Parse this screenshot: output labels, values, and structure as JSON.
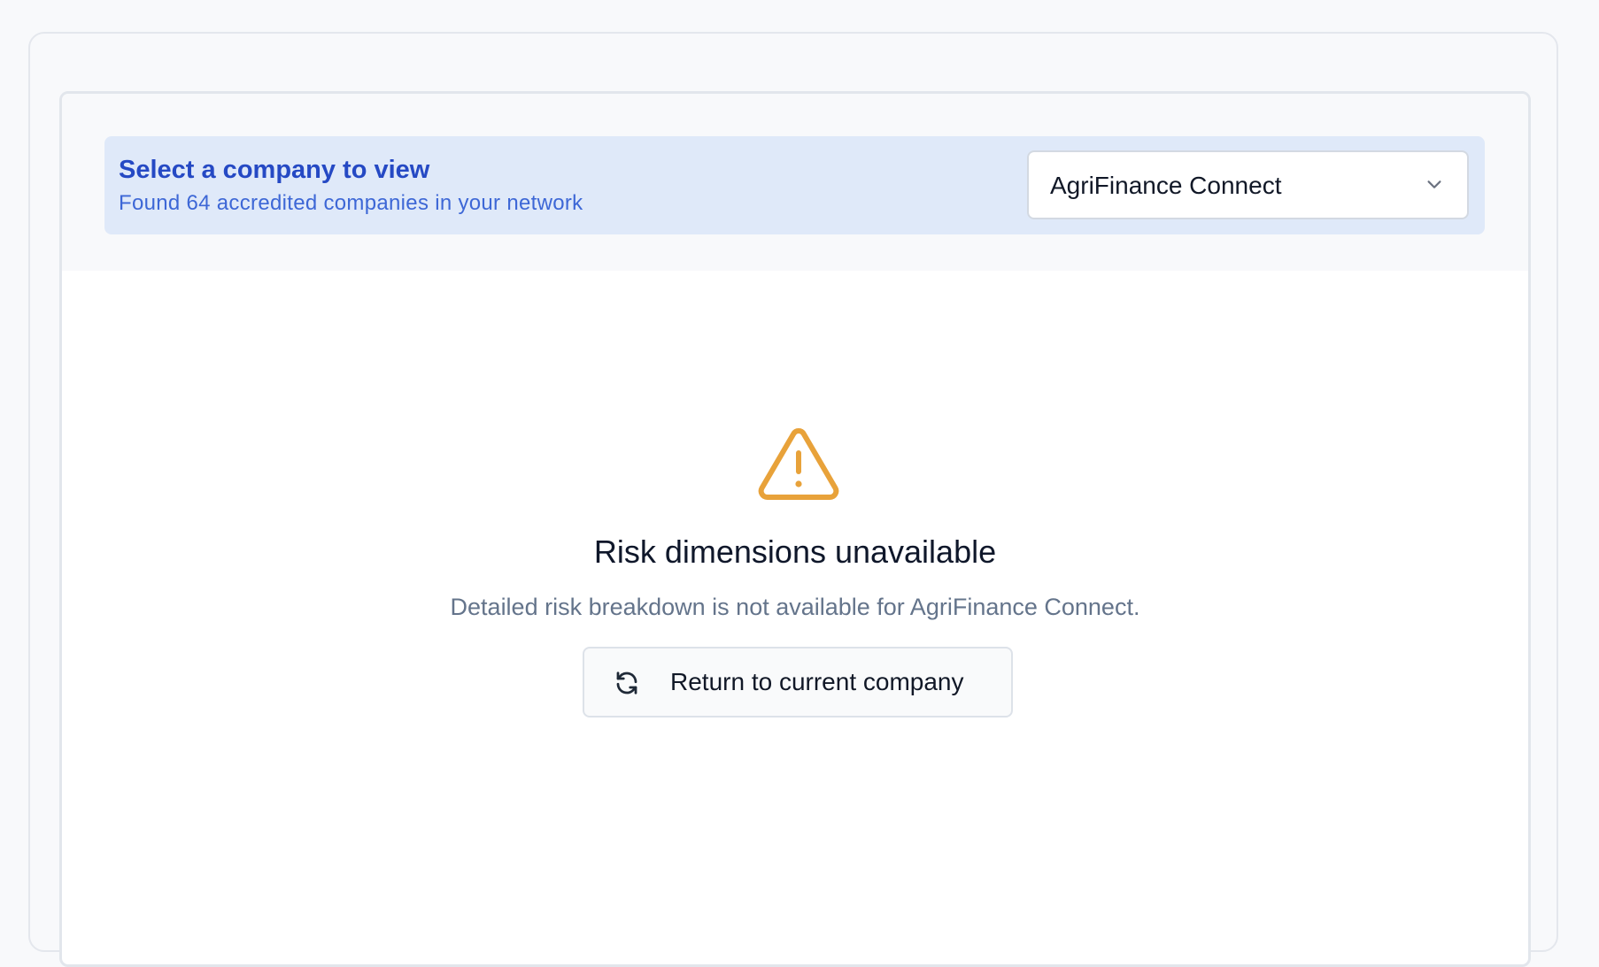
{
  "selector": {
    "title": "Select a company to view",
    "subtitle": "Found 64 accredited companies in your network",
    "selected_company": "AgriFinance Connect",
    "dropdown_icon": "chevron-down-icon"
  },
  "empty_state": {
    "icon": "warning-triangle-icon",
    "icon_color": "#e8a23a",
    "title": "Risk dimensions unavailable",
    "description": "Detailed risk breakdown is not available for AgriFinance Connect.",
    "button_icon": "refresh-icon",
    "button_label": "Return to current company"
  },
  "colors": {
    "banner_background": "#dfe9f9",
    "banner_title": "#2549c4",
    "banner_subtitle": "#3d67d6",
    "muted_text": "#64748b"
  }
}
